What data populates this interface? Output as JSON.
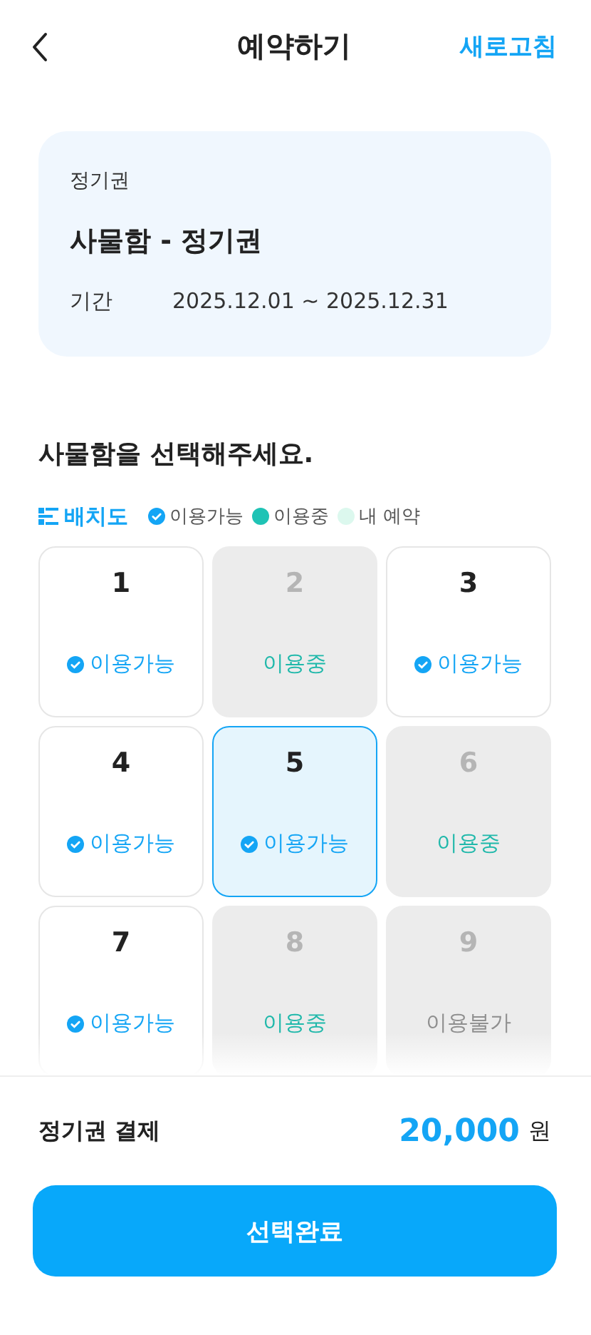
{
  "header": {
    "title": "예약하기",
    "action": "새로고침"
  },
  "pass_card": {
    "category": "정기권",
    "name": "사물함 - 정기권",
    "period_label": "기간",
    "period": "2025.12.01 ~ 2025.12.31"
  },
  "section_title": "사물함을 선택해주세요.",
  "legend": {
    "map_label": "배치도",
    "items": [
      {
        "kind": "check",
        "label": "이용가능",
        "color": "#14a5f5"
      },
      {
        "kind": "dot",
        "label": "이용중",
        "color": "#1fc3b5"
      },
      {
        "kind": "dot",
        "label": "내 예약",
        "color": "#dcf8ee"
      }
    ]
  },
  "lockers": [
    {
      "number": "1",
      "kind": "available",
      "label": "이용가능",
      "selected": false
    },
    {
      "number": "2",
      "kind": "in_use",
      "label": "이용중",
      "selected": false
    },
    {
      "number": "3",
      "kind": "available",
      "label": "이용가능",
      "selected": false
    },
    {
      "number": "4",
      "kind": "available",
      "label": "이용가능",
      "selected": false
    },
    {
      "number": "5",
      "kind": "available",
      "label": "이용가능",
      "selected": true
    },
    {
      "number": "6",
      "kind": "in_use",
      "label": "이용중",
      "selected": false
    },
    {
      "number": "7",
      "kind": "available",
      "label": "이용가능",
      "selected": false
    },
    {
      "number": "8",
      "kind": "in_use",
      "label": "이용중",
      "selected": false
    },
    {
      "number": "9",
      "kind": "unavailable",
      "label": "이용불가",
      "selected": false
    }
  ],
  "payment": {
    "label": "정기권 결제",
    "amount": "20,000",
    "unit": "원"
  },
  "confirm_button": "선택완료"
}
